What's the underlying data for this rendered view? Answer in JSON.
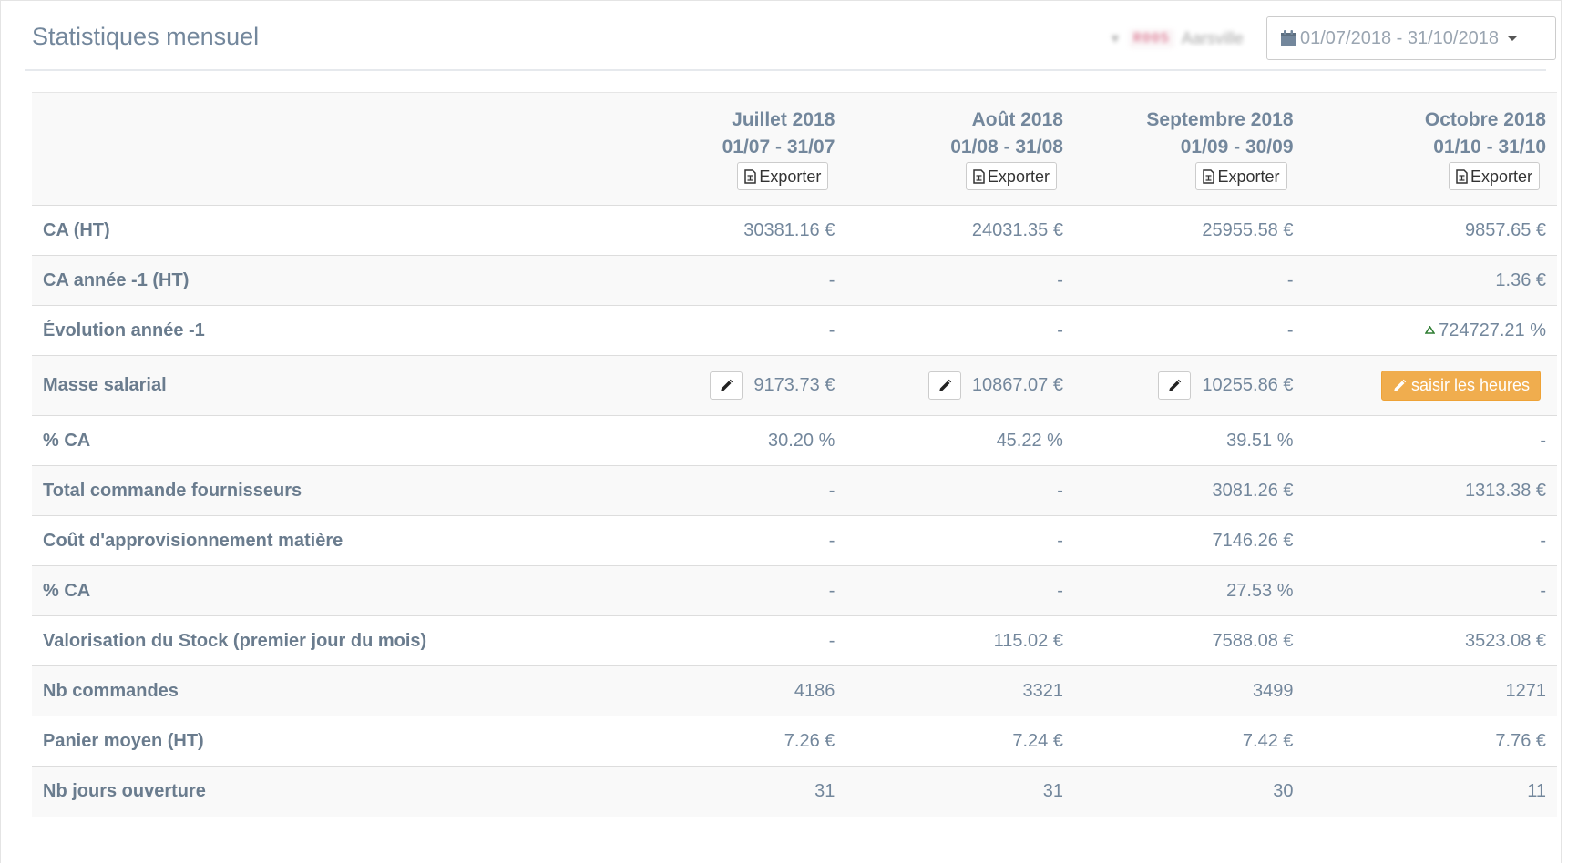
{
  "header": {
    "title": "Statistiques mensuel",
    "store_code": "R005",
    "store_name": "Aarsville",
    "date_range": "01/07/2018 - 31/10/2018"
  },
  "columns": [
    {
      "month": "Juillet 2018",
      "range": "01/07 - 31/07",
      "export_label": "Exporter"
    },
    {
      "month": "Août 2018",
      "range": "01/08 - 31/08",
      "export_label": "Exporter"
    },
    {
      "month": "Septembre 2018",
      "range": "01/09 - 30/09",
      "export_label": "Exporter"
    },
    {
      "month": "Octobre 2018",
      "range": "01/10 - 31/10",
      "export_label": "Exporter"
    }
  ],
  "rows": [
    {
      "label": "CA (HT)",
      "values": [
        "30381.16 €",
        "24031.35 €",
        "25955.58 €",
        "9857.65 €"
      ]
    },
    {
      "label": "CA année -1 (HT)",
      "values": [
        "-",
        "-",
        "-",
        "1.36 €"
      ]
    },
    {
      "label": "Évolution année -1",
      "values": [
        "-",
        "-",
        "-",
        "724727.21 %"
      ]
    },
    {
      "label": "Masse salarial",
      "values": [
        "9173.73 €",
        "10867.07 €",
        "10255.86 €"
      ],
      "action_label": "saisir les heures"
    },
    {
      "label": "% CA",
      "values": [
        "30.20 %",
        "45.22 %",
        "39.51 %",
        "-"
      ]
    },
    {
      "label": "Total commande fournisseurs",
      "values": [
        "-",
        "-",
        "3081.26 €",
        "1313.38 €"
      ]
    },
    {
      "label": "Coût d'approvisionnement matière",
      "values": [
        "-",
        "-",
        "7146.26 €",
        "-"
      ]
    },
    {
      "label": "% CA",
      "values": [
        "-",
        "-",
        "27.53 %",
        "-"
      ]
    },
    {
      "label": "Valorisation du Stock (premier jour du mois)",
      "values": [
        "-",
        "115.02 €",
        "7588.08 €",
        "3523.08 €"
      ]
    },
    {
      "label": "Nb commandes",
      "values": [
        "4186",
        "3321",
        "3499",
        "1271"
      ]
    },
    {
      "label": "Panier moyen (HT)",
      "values": [
        "7.26 €",
        "7.24 €",
        "7.42 €",
        "7.76 €"
      ]
    },
    {
      "label": "Nb jours ouverture",
      "values": [
        "31",
        "31",
        "30",
        "11"
      ]
    }
  ],
  "colors": {
    "accent_orange": "#f0ad4e",
    "trend_up": "#2e7d32",
    "text": "#73879c"
  },
  "icons": {
    "calendar": "calendar-icon",
    "export": "file-excel-icon",
    "edit": "pencil-icon",
    "trend": "triangle-up-icon"
  }
}
